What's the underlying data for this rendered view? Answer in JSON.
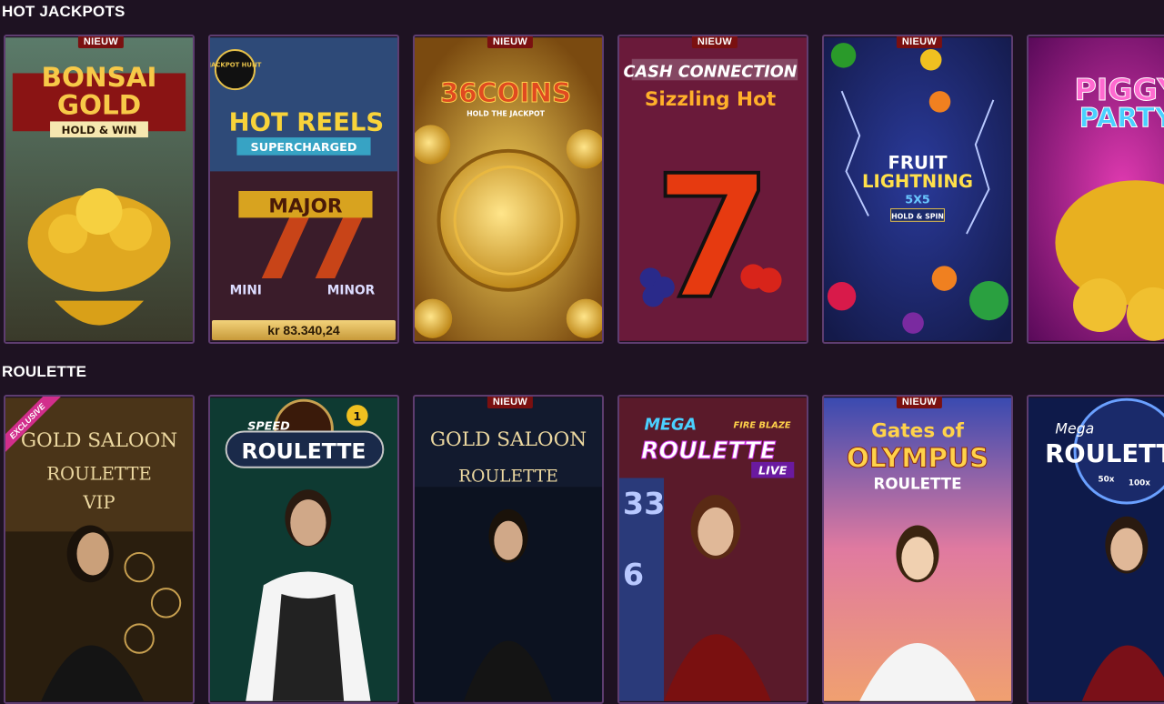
{
  "sections": {
    "hot_jackpots": {
      "title": "HOT JACKPOTS",
      "games": [
        {
          "name": "Bonsai Gold Hold & Win",
          "badge": "NIEUW"
        },
        {
          "name": "Hot Reels Supercharged",
          "badge": "",
          "jackpot_label": "JACKPOT HUNT",
          "jackpot": "kr 83.340,24"
        },
        {
          "name": "36 Coins",
          "badge": "NIEUW"
        },
        {
          "name": "Cash Connection Sizzling Hot",
          "badge": "NIEUW"
        },
        {
          "name": "Fruit Lightning 5x5",
          "badge": "NIEUW"
        },
        {
          "name": "Piggy Party",
          "badge": ""
        }
      ]
    },
    "roulette": {
      "title": "ROULETTE",
      "games": [
        {
          "name": "Gold Saloon Roulette VIP",
          "badge": "",
          "tag": "EXCLUSIVE"
        },
        {
          "name": "Speed Roulette",
          "badge": "",
          "number": "1"
        },
        {
          "name": "Gold Saloon Roulette",
          "badge": "NIEUW"
        },
        {
          "name": "Mega Fire Blaze Roulette Live",
          "badge": ""
        },
        {
          "name": "Gates of Olympus Roulette",
          "badge": "NIEUW"
        },
        {
          "name": "Mega Roulette",
          "badge": ""
        }
      ]
    }
  },
  "art_text": {
    "bonsai": [
      "BONSAI",
      "GOLD",
      "HOLD & WIN"
    ],
    "hotreels": [
      "HOT REELS",
      "SUPERCHARGED",
      "MAJOR",
      "MINI",
      "MINOR"
    ],
    "coins": [
      "36COINS",
      "HOLD THE JACKPOT"
    ],
    "cash": [
      "CASH CONNECTION",
      "Sizzling Hot"
    ],
    "fruit": [
      "FRUIT",
      "LIGHTNING",
      "5X5",
      "HOLD & SPIN"
    ],
    "piggy": [
      "PIGGY",
      "PARTY"
    ],
    "saloon_vip": [
      "GOLD SALOON",
      "ROULETTE",
      "VIP"
    ],
    "speed": [
      "SPEED",
      "ROULETTE"
    ],
    "saloon": [
      "GOLD SALOON",
      "ROULETTE"
    ],
    "mega_fire": [
      "MEGA",
      "FIRE BLAZE",
      "ROULETTE",
      "LIVE"
    ],
    "olympus": [
      "Gates of",
      "OLYMPUS",
      "ROULETTE"
    ],
    "mega": [
      "Mega",
      "ROULETTE",
      "50x",
      "100x"
    ]
  },
  "colors": {
    "background": "#1e1222",
    "card_border": "#5e3d70",
    "badge": "#7a1010",
    "exclusive": "#d22e8c"
  }
}
